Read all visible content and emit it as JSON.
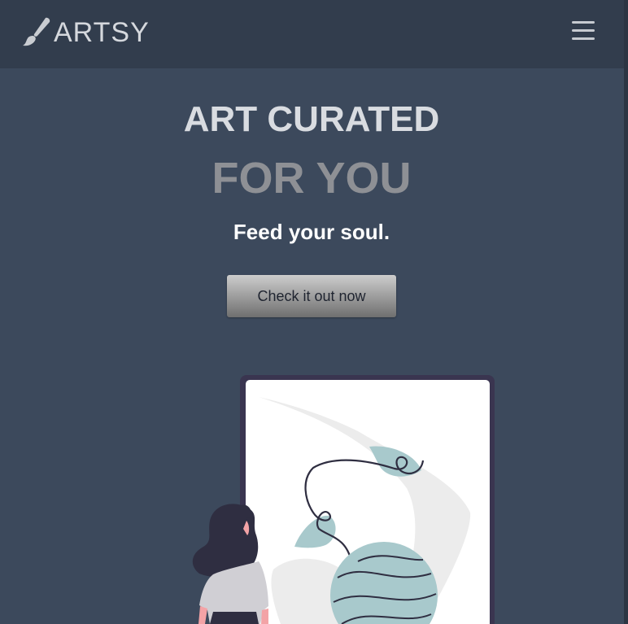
{
  "brand": {
    "name": "ARTSY"
  },
  "nav": {
    "menu_icon": "hamburger-menu-icon"
  },
  "hero": {
    "headline_line1": "ART CURATED",
    "headline_line2": "FOR YOU",
    "tagline": "Feed your soul.",
    "cta_label": "Check it out now"
  },
  "colors": {
    "background": "#3c495c",
    "navbar": "#323d4d",
    "accent_teal": "#a8c9cc",
    "frame": "#3a3550"
  }
}
